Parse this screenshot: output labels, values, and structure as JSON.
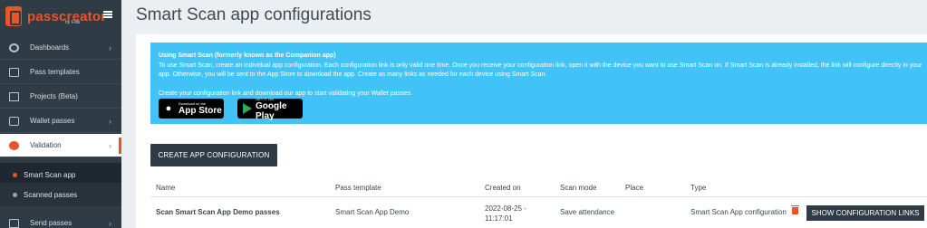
{
  "brand": {
    "name": "passcreator",
    "by": "by Fobi",
    "accent": "#e8552b"
  },
  "sidebar": {
    "items": [
      {
        "label": "Dashboards",
        "icon": "gauge-icon",
        "chevron": "›"
      },
      {
        "label": "Pass templates",
        "icon": "card-icon",
        "chevron": ""
      },
      {
        "label": "Projects (Beta)",
        "icon": "grid-icon",
        "chevron": ""
      },
      {
        "label": "Wallet passes",
        "icon": "wallet-icon",
        "chevron": "›"
      },
      {
        "label": "Validation",
        "icon": "globe-icon",
        "chevron": "›",
        "active": true
      },
      {
        "label": "Send passes",
        "icon": "send-icon",
        "chevron": "›"
      }
    ],
    "sub_items": [
      {
        "label": "Smart Scan app",
        "selected": true
      },
      {
        "label": "Scanned passes",
        "selected": false
      }
    ]
  },
  "page": {
    "title": "Smart Scan app configurations"
  },
  "info": {
    "title": "Using Smart Scan (formerly known as the Companion app)",
    "body": "To use Smart Scan, create an individual app configuration. Each configuration link is only valid one time. Once you receive your configuration link, open it with the device you want to use Smart Scan on. If Smart Scan is already installed, the link will configure directly in your app. Otherwise, you will be sent to the App Store to download the app. Create as many links as needed for each device using Smart Scan.",
    "cta": "Create your configuration link and download our app to start validating your Wallet passes.",
    "app_store": {
      "small": "Download on the",
      "big": "App Store"
    },
    "google_play": {
      "small": "GET IT ON",
      "big": "Google Play"
    }
  },
  "actions": {
    "create": "CREATE APP CONFIGURATION",
    "show_links": "SHOW CONFIGURATION LINKS"
  },
  "table": {
    "columns": [
      "Name",
      "Pass template",
      "Created on",
      "Scan mode",
      "Place",
      "Type"
    ],
    "rows": [
      {
        "name": "Scan Smart Scan App Demo passes",
        "pass_template": "Smart Scan App Demo",
        "created_date": "2022-08-25 -",
        "created_time": "11:17:01",
        "scan_mode": "Save attendance",
        "place": "",
        "type": "Smart Scan App configuration"
      }
    ]
  }
}
